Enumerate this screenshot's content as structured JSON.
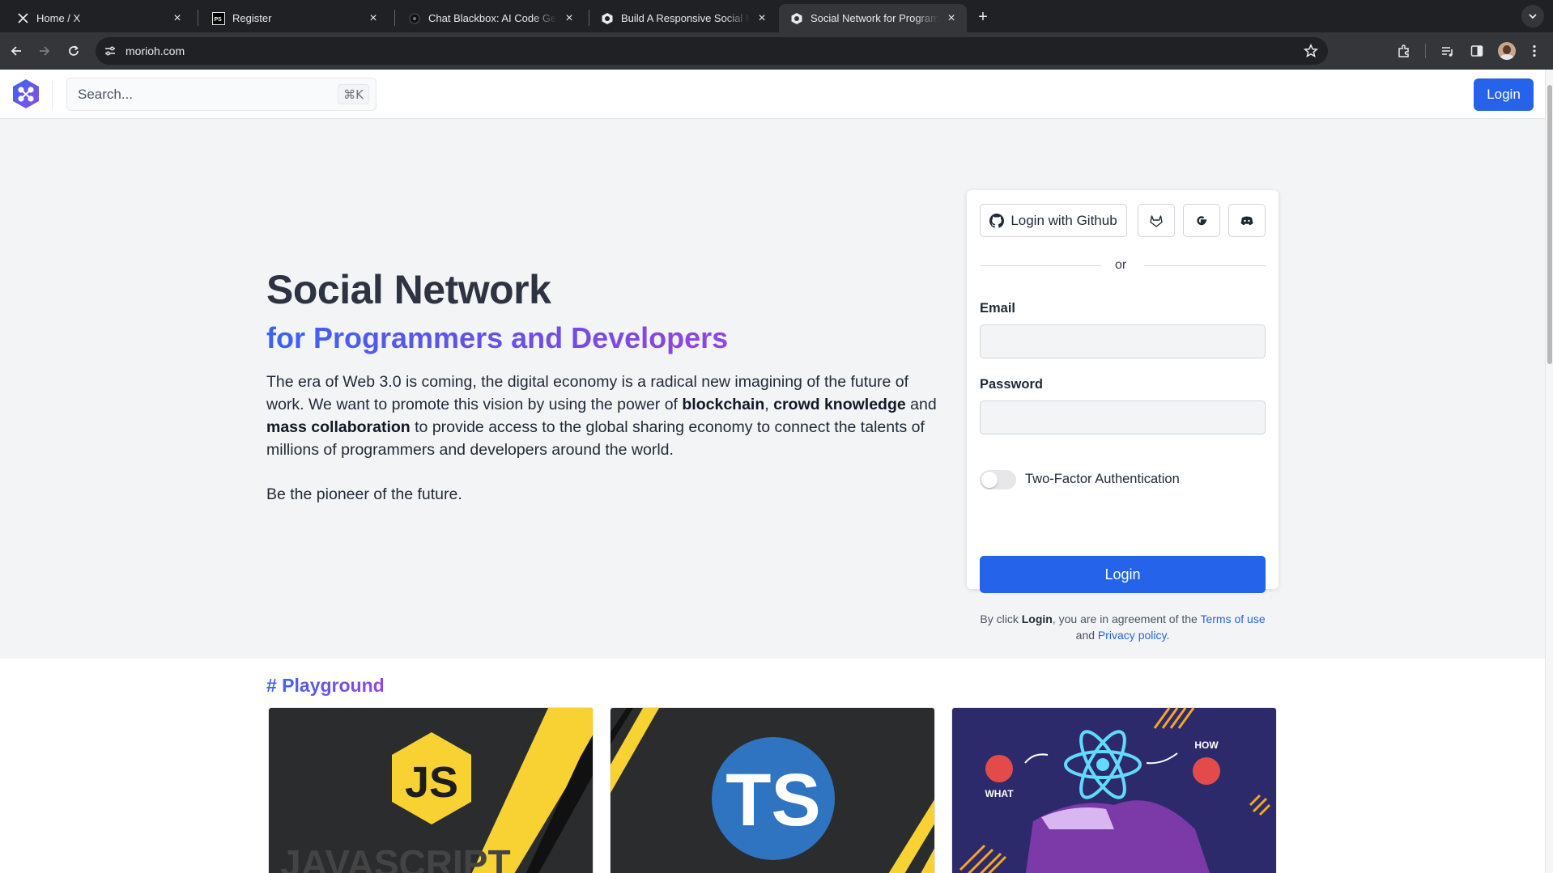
{
  "browser": {
    "tabs": [
      {
        "title": "Home / X",
        "icon": "x-logo-icon"
      },
      {
        "title": "Register",
        "icon": "ps-logo-icon"
      },
      {
        "title": "Chat Blackbox: AI Code Generation",
        "icon": "blackbox-icon"
      },
      {
        "title": "Build A Responsive Social Media",
        "icon": "morioh-icon"
      },
      {
        "title": "Social Network for Programmers",
        "icon": "morioh-icon"
      }
    ],
    "url": "morioh.com"
  },
  "header": {
    "search_placeholder": "Search...",
    "search_shortcut": "⌘K",
    "login_label": "Login"
  },
  "hero": {
    "title": "Social Network",
    "subtitle": "for Programmers and Developers",
    "p_before": "The era of Web 3.0 is coming, the digital economy is a radical new imagining of the future of work. We want to promote this vision by using the power of ",
    "b1": "blockchain",
    "sep1": ", ",
    "b2": "crowd knowledge",
    "sep2": " and ",
    "b3": "mass collaboration",
    "p_after": " to provide access to the global sharing economy to connect the talents of millions of programmers and developers around the world.",
    "cta": "Be the pioneer of the future."
  },
  "login_card": {
    "github_label": "Login with Github",
    "divider": "or",
    "email_label": "Email",
    "password_label": "Password",
    "two_factor_label": "Two-Factor Authentication",
    "two_factor_enabled": false,
    "login_label": "Login",
    "terms_prefix": "By click ",
    "terms_bold": "Login",
    "terms_mid": ", you are in agreement of the ",
    "terms_link": "Terms of use",
    "terms_and": " and ",
    "privacy_link": "Privacy policy",
    "terms_end": "."
  },
  "playground": {
    "title": "# Playground",
    "cards": [
      {
        "badge": "JS",
        "caption": "JAVASCRIPT"
      },
      {
        "badge": "TS"
      },
      {
        "label_what": "WHAT",
        "label_how": "HOW"
      }
    ]
  },
  "colors": {
    "primary": "#2563eb",
    "gradient_start": "#3b63f0",
    "gradient_end": "#9146e0",
    "js_yellow": "#f7d232"
  }
}
